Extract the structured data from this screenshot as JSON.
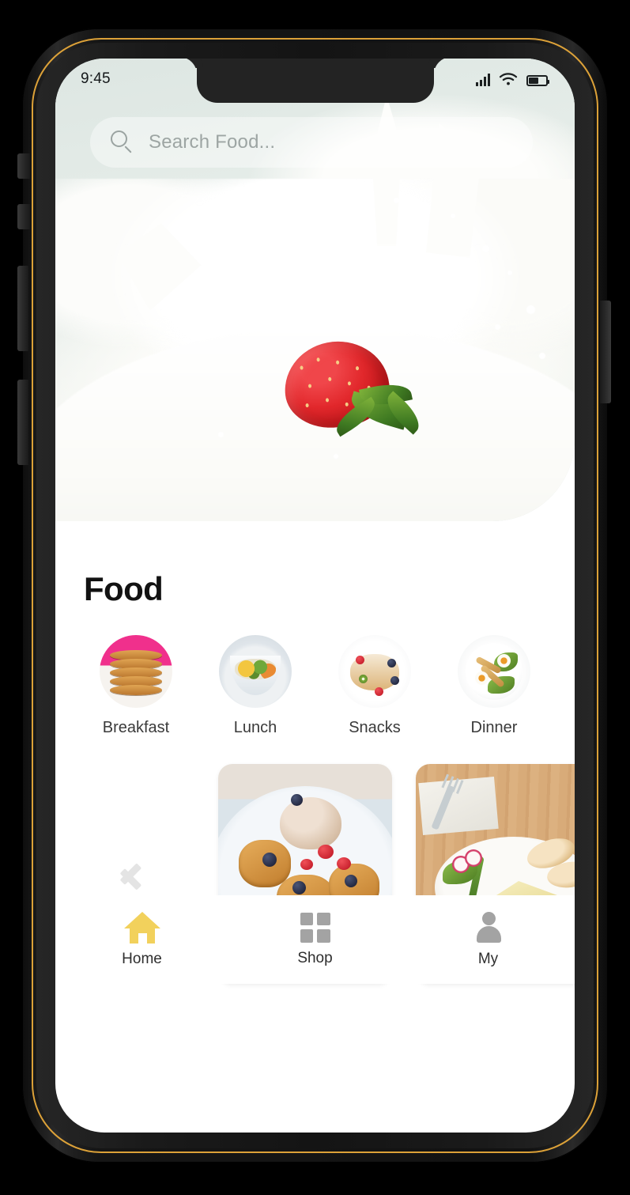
{
  "status_bar": {
    "time": "9:45",
    "signal_icon": "signal-bars-icon",
    "wifi_icon": "wifi-icon",
    "battery_icon": "battery-icon",
    "battery_level_pct": 52
  },
  "search": {
    "icon": "search-icon",
    "placeholder": "Search Food...",
    "value": ""
  },
  "hero": {
    "name": "strawberry-milk-splash-banner",
    "alt": "Strawberry splashing into milk"
  },
  "main": {
    "section_title": "Food"
  },
  "categories": [
    {
      "label": "Breakfast",
      "image": "stack-of-pancakes-thumbnail"
    },
    {
      "label": "Lunch",
      "image": "curry-bowl-thumbnail"
    },
    {
      "label": "Snacks",
      "image": "berry-dessert-thumbnail"
    },
    {
      "label": "Dinner",
      "image": "chicken-salad-plate-thumbnail"
    }
  ],
  "carousel": {
    "prev_arrow_icon": "chevron-left-icon",
    "cards": [
      {
        "image": "waffles-with-ice-cream-and-berries"
      },
      {
        "image": "cheese-bread-and-salad-plate-on-wood-table"
      }
    ]
  },
  "bottom_nav": {
    "items": [
      {
        "label": "Home",
        "icon": "home-icon",
        "active": true
      },
      {
        "label": "Shop",
        "icon": "grid-icon",
        "active": false
      },
      {
        "label": "My",
        "icon": "person-icon",
        "active": false
      }
    ]
  },
  "colors": {
    "hero_background": "#d6e2de",
    "active_nav": "#f2d15c",
    "inactive_nav": "#a3a3a3",
    "frame_accent": "#e7a93a",
    "title": "#121212",
    "placeholder": "#9da5a3"
  }
}
